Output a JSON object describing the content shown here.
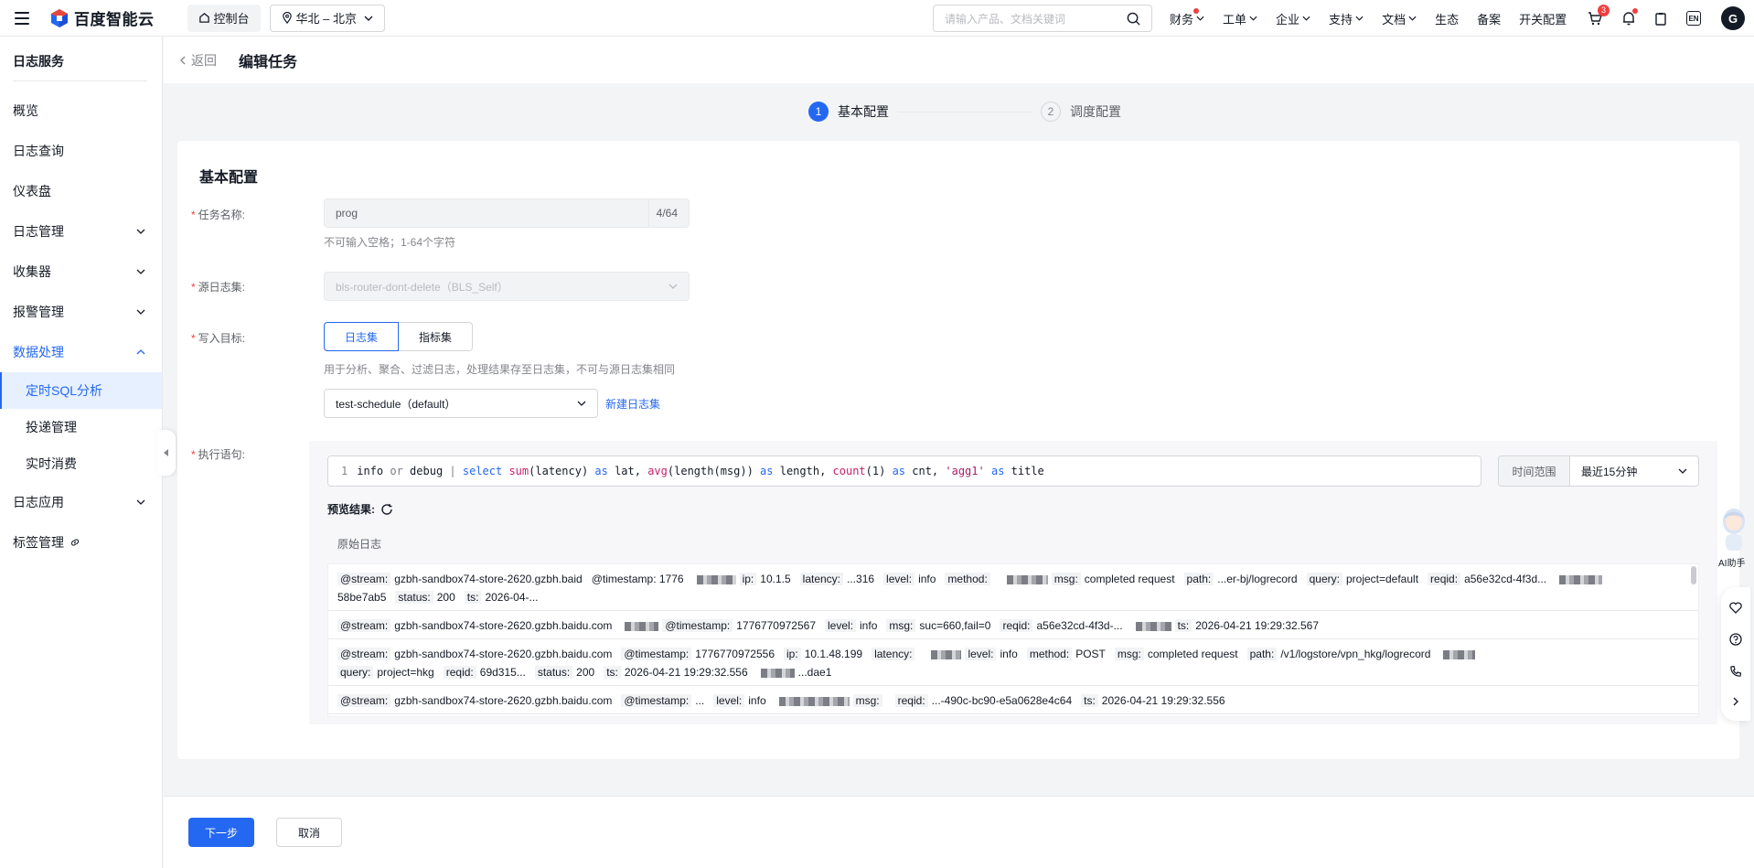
{
  "topbar": {
    "brand": "百度智能云",
    "console_label": "控制台",
    "region_label": "华北 – 北京",
    "search_placeholder": "请输入产品、文档关键词",
    "nav": [
      "财务",
      "工单",
      "企业",
      "支持",
      "文档",
      "生态",
      "备案",
      "开关配置"
    ],
    "cart_badge": "3",
    "lang": "EN",
    "avatar_letter": "G"
  },
  "sidebar": {
    "title": "日志服务",
    "items": [
      {
        "label": "概览"
      },
      {
        "label": "日志查询"
      },
      {
        "label": "仪表盘"
      },
      {
        "label": "日志管理"
      },
      {
        "label": "收集器"
      },
      {
        "label": "报警管理"
      },
      {
        "label": "数据处理"
      },
      {
        "label": "日志应用"
      },
      {
        "label": "标签管理"
      }
    ],
    "sub_items": [
      "定时SQL分析",
      "投递管理",
      "实时消费"
    ]
  },
  "header": {
    "back_label": "返回",
    "title": "编辑任务"
  },
  "steps": [
    {
      "num": "1",
      "label": "基本配置"
    },
    {
      "num": "2",
      "label": "调度配置"
    }
  ],
  "form": {
    "section_title": "基本配置",
    "task_name_label": "任务名称:",
    "task_name_value": "prog",
    "task_name_count": "4/64",
    "task_name_hint": "不可输入空格；1-64个字符",
    "source_label": "源日志集:",
    "source_value": "bls-router-dont-delete（BLS_Self）",
    "target_label": "写入目标:",
    "target_options": [
      "日志集",
      "指标集"
    ],
    "target_hint": "用于分析、聚合、过滤日志，处理结果存至日志集，不可与源日志集相同",
    "target_logset": "test-schedule（default）",
    "new_logset_link": "新建日志集",
    "exec_label": "执行语句:",
    "code_line_no": "1",
    "time_range_label": "时间范围",
    "time_range_value": "最近15分钟",
    "preview_label": "预览结果:",
    "raw_log_label": "原始日志"
  },
  "code_tokens": [
    {
      "t": "info",
      "c": ""
    },
    {
      "t": " or ",
      "c": "op"
    },
    {
      "t": "debug",
      "c": ""
    },
    {
      "t": " | ",
      "c": "op"
    },
    {
      "t": "select",
      "c": "kw"
    },
    {
      "t": " ",
      "c": ""
    },
    {
      "t": "sum",
      "c": "fn"
    },
    {
      "t": "(latency) ",
      "c": ""
    },
    {
      "t": "as",
      "c": "kw"
    },
    {
      "t": " lat, ",
      "c": ""
    },
    {
      "t": "avg",
      "c": "fn"
    },
    {
      "t": "(length(msg)) ",
      "c": ""
    },
    {
      "t": "as",
      "c": "kw"
    },
    {
      "t": " length, ",
      "c": ""
    },
    {
      "t": "count",
      "c": "fn"
    },
    {
      "t": "(1) ",
      "c": ""
    },
    {
      "t": "as",
      "c": "kw"
    },
    {
      "t": " cnt, ",
      "c": ""
    },
    {
      "t": "'agg1'",
      "c": "str"
    },
    {
      "t": " ",
      "c": ""
    },
    {
      "t": "as",
      "c": "kw"
    },
    {
      "t": " title",
      "c": ""
    }
  ],
  "logs": [
    {
      "parts": [
        [
          "@stream:",
          "gzbh-sandbox74-store-2620.gzbh.baid"
        ],
        [
          "",
          "@timestamp: 1776"
        ],
        [
          "ip:",
          "10.1.5"
        ],
        [
          "latency:",
          "...316"
        ],
        [
          "level:",
          "info"
        ],
        [
          "method:",
          ""
        ],
        [
          "msg:",
          "completed request"
        ],
        [
          "path:",
          "...er-bj/logrecord"
        ],
        [
          "query:",
          "project=default"
        ],
        [
          "reqid:",
          "a56e32cd-4f3d..."
        ],
        [
          "",
          "58be7ab5"
        ],
        [
          "status:",
          "200"
        ],
        [
          "ts:",
          "2026-04-..."
        ]
      ]
    },
    {
      "parts": [
        [
          "@stream:",
          "gzbh-sandbox74-store-2620.gzbh.baidu.com"
        ],
        [
          "@timestamp:",
          "1776770972567"
        ],
        [
          "level:",
          "info"
        ],
        [
          "msg:",
          "suc=660,fail=0"
        ],
        [
          "reqid:",
          "a56e32cd-4f3d-..."
        ],
        [
          "ts:",
          "2026-04-21 19:29:32.567"
        ]
      ]
    },
    {
      "parts": [
        [
          "@stream:",
          "gzbh-sandbox74-store-2620.gzbh.baidu.com"
        ],
        [
          "@timestamp:",
          "1776770972556"
        ],
        [
          "ip:",
          "10.1.48.199"
        ],
        [
          "latency:",
          ""
        ],
        [
          "level:",
          "info"
        ],
        [
          "method:",
          "POST"
        ],
        [
          "msg:",
          "completed request"
        ],
        [
          "path:",
          "/v1/logstore/vpn_hkg/logrecord"
        ],
        [
          "query:",
          "project=hkg"
        ],
        [
          "reqid:",
          "69d315..."
        ],
        [
          "status:",
          "200"
        ],
        [
          "ts:",
          "2026-04-21 19:29:32.556"
        ],
        [
          "",
          "...dae1"
        ]
      ]
    },
    {
      "parts": [
        [
          "@stream:",
          "gzbh-sandbox74-store-2620.gzbh.baidu.com"
        ],
        [
          "@timestamp:",
          "..."
        ],
        [
          "level:",
          "info"
        ],
        [
          "msg:",
          ""
        ],
        [
          "reqid:",
          "...-490c-bc90-e5a0628e4c64"
        ],
        [
          "ts:",
          "2026-04-21 19:29:32.556"
        ]
      ]
    }
  ],
  "footer": {
    "next_label": "下一步",
    "cancel_label": "取消"
  },
  "assistant": {
    "label": "AI助手"
  },
  "colors": {
    "primary": "#2468f2",
    "danger": "#f33e3e"
  }
}
